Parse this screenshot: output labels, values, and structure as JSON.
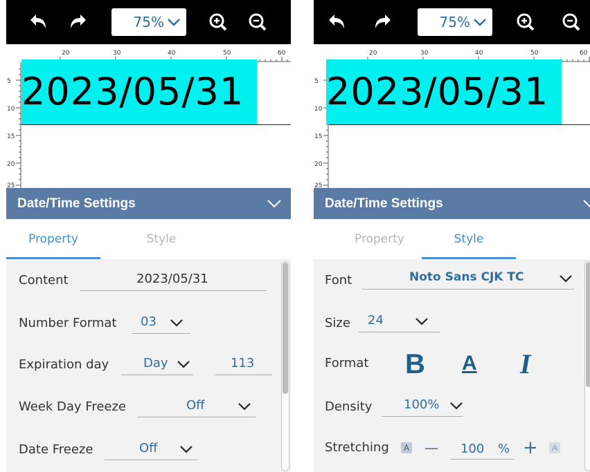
{
  "toolbar": {
    "undo_icon": "undo-icon",
    "redo_icon": "redo-icon",
    "zoom_value": "75%",
    "zoom_in_icon": "zoom-in-icon",
    "zoom_out_icon": "zoom-out-icon"
  },
  "canvas": {
    "date_text": "2023/05/31",
    "ruler_top_ticks": [
      "20",
      "30",
      "40",
      "50",
      "60"
    ],
    "ruler_left_ticks": [
      "5",
      "10",
      "15",
      "20",
      "25"
    ],
    "selection_color": "#00f0f0"
  },
  "settings": {
    "title": "Date/Time Settings"
  },
  "tabs": {
    "property": "Property",
    "style": "Style"
  },
  "property": {
    "content_label": "Content",
    "content_value": "2023/05/31",
    "number_format_label": "Number Format",
    "number_format_value": "03",
    "expiration_label": "Expiration day",
    "expiration_unit": "Day",
    "expiration_value": "113",
    "week_day_freeze_label": "Week Day Freeze",
    "week_day_freeze_value": "Off",
    "date_freeze_label": "Date Freeze",
    "date_freeze_value": "Off"
  },
  "style": {
    "font_label": "Font",
    "font_value": "Noto Sans CJK TC",
    "size_label": "Size",
    "size_value": "24",
    "format_label": "Format",
    "bold_glyph": "B",
    "underline_glyph": "A",
    "italic_glyph": "I",
    "density_label": "Density",
    "density_value": "100%",
    "stretching_label": "Stretching",
    "stretch_small_icon": "A",
    "stretch_minus": "—",
    "stretch_value": "100",
    "stretch_unit": "%",
    "stretch_plus": "+",
    "stretch_large_icon": "A"
  },
  "colors": {
    "accent": "#2f6e9e",
    "header_bg": "#5a7ba3",
    "tab_active": "#3f8fcf"
  }
}
